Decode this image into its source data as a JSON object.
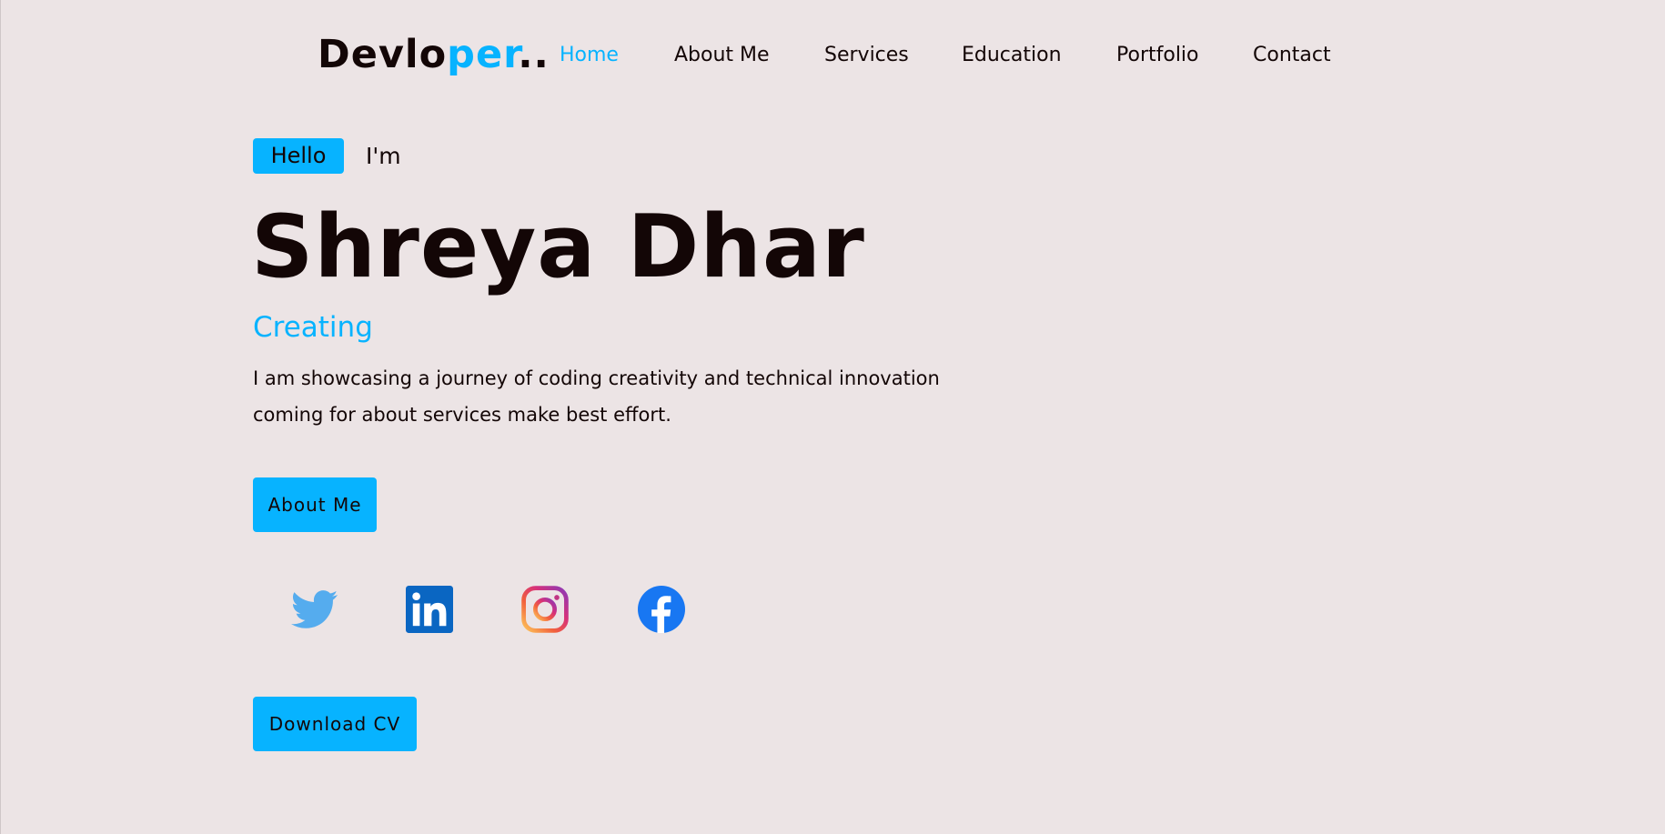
{
  "logo": {
    "part1": "Devlo",
    "part2": "per",
    "part3": ".."
  },
  "nav": {
    "items": [
      {
        "label": "Home",
        "active": true
      },
      {
        "label": "About Me",
        "active": false
      },
      {
        "label": "Services",
        "active": false
      },
      {
        "label": "Education",
        "active": false
      },
      {
        "label": "Portfolio",
        "active": false
      },
      {
        "label": "Contact",
        "active": false
      }
    ]
  },
  "hero": {
    "badge": "Hello",
    "greeting": "I'm",
    "name": "Shreya Dhar",
    "typed": "Creating",
    "description": "I am showcasing a journey of coding creativity and technical innovation coming for about services make best effort.",
    "about_button": "About Me",
    "cv_button": "Download CV"
  },
  "socials": [
    {
      "icon": "twitter-icon"
    },
    {
      "icon": "linkedin-icon"
    },
    {
      "icon": "instagram-icon"
    },
    {
      "icon": "facebook-icon"
    }
  ],
  "colors": {
    "background": "#ece4e5",
    "accent": "#07b3ff",
    "text": "#130606",
    "twitter": "#55acee",
    "linkedin": "#0a66c2",
    "facebook": "#1877f2"
  }
}
